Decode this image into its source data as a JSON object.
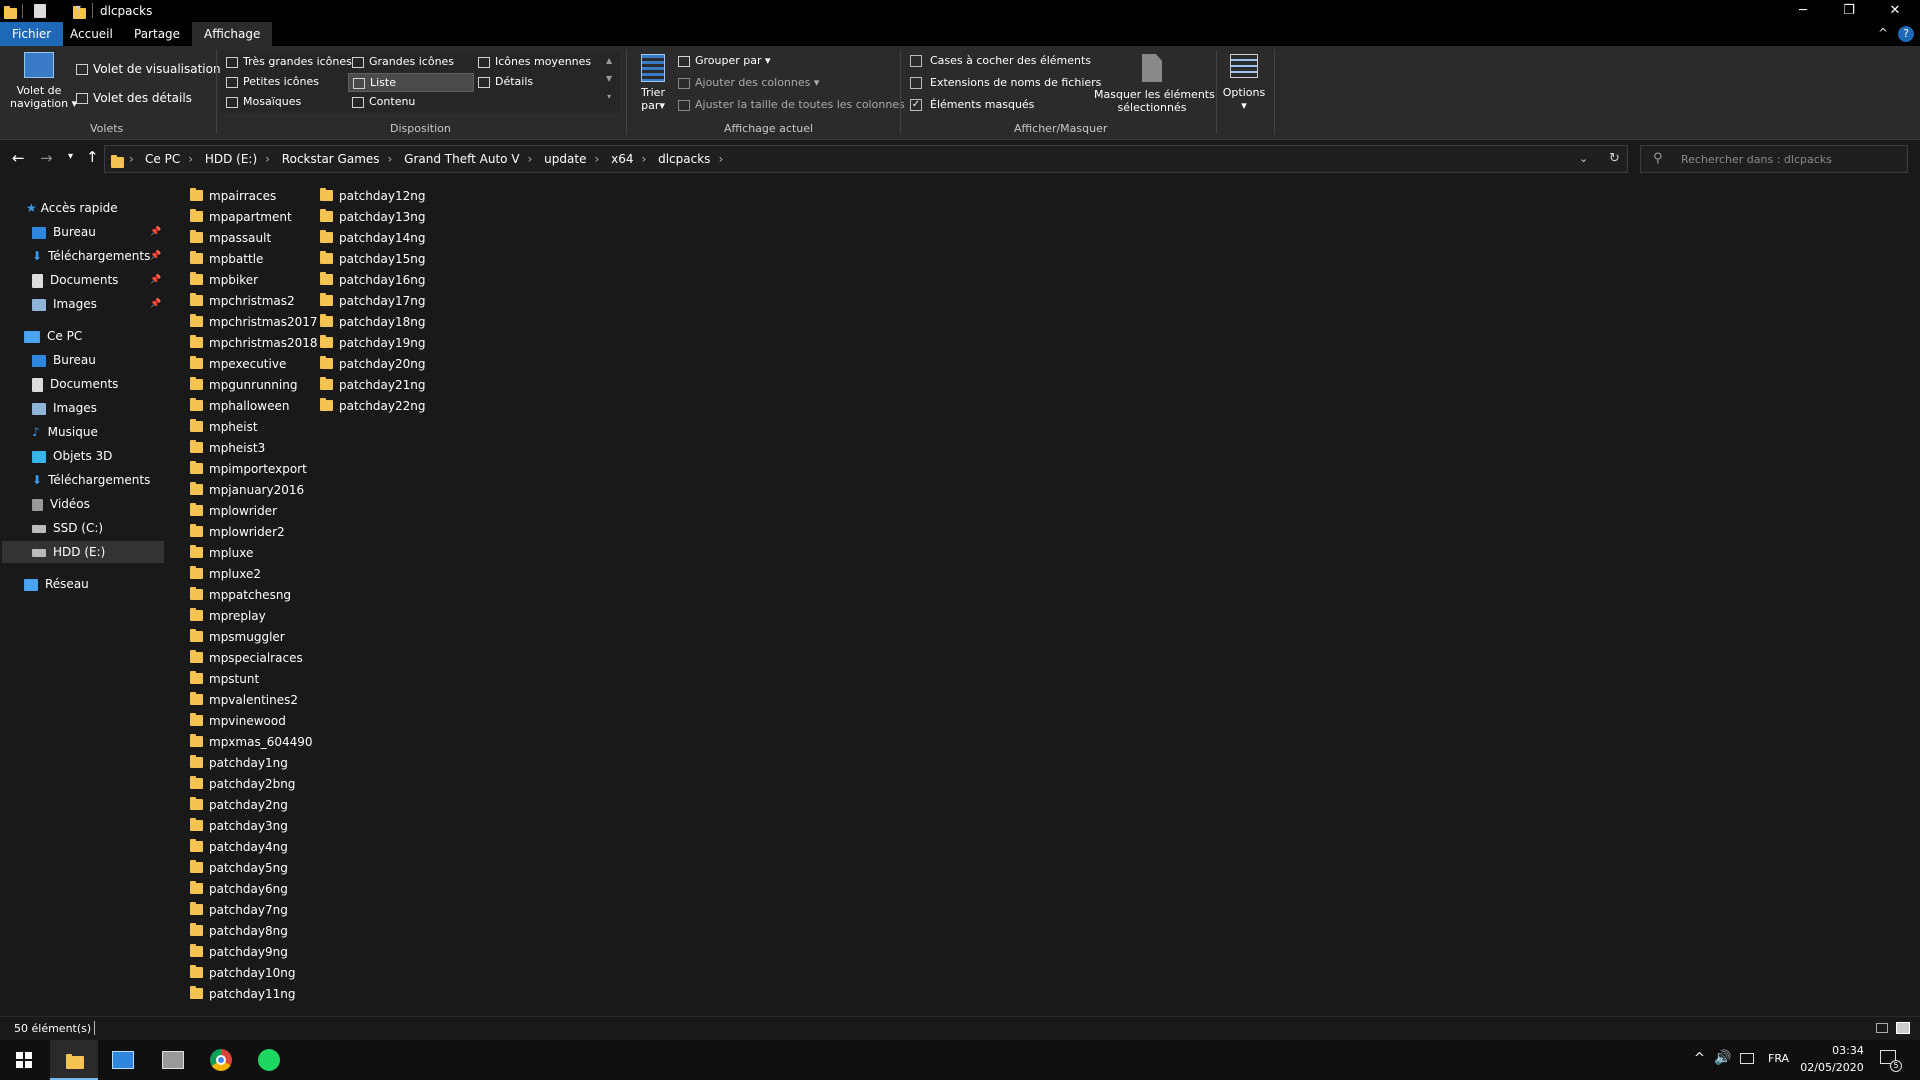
{
  "window": {
    "title": "dlcpacks"
  },
  "tabs": [
    "Fichier",
    "Accueil",
    "Partage",
    "Affichage"
  ],
  "ribbon": {
    "volets": {
      "nav_pane_line1": "Volet de",
      "nav_pane_line2": "navigation",
      "preview": "Volet de visualisation",
      "details": "Volet des détails",
      "group": "Volets"
    },
    "disposition": {
      "items": [
        "Très grandes icônes",
        "Grandes icônes",
        "Icônes moyennes",
        "Petites icônes",
        "Liste",
        "Détails",
        "Mosaïques",
        "Contenu"
      ],
      "group": "Disposition"
    },
    "affichage": {
      "sort_line1": "Trier",
      "sort_line2": "par",
      "group_by": "Grouper par",
      "add_columns": "Ajouter des colonnes",
      "fit_columns": "Ajuster la taille de toutes les colonnes",
      "group": "Affichage actuel"
    },
    "afficher": {
      "checkboxes": "Cases à cocher des éléments",
      "extensions": "Extensions de noms de fichiers",
      "hidden": "Éléments masqués",
      "hide_selected_line1": "Masquer les éléments",
      "hide_selected_line2": "sélectionnés",
      "group": "Afficher/Masquer"
    },
    "options": "Options"
  },
  "address": {
    "crumbs": [
      "Ce PC",
      "HDD (E:)",
      "Rockstar Games",
      "Grand Theft Auto V",
      "update",
      "x64",
      "dlcpacks"
    ],
    "search_placeholder": "Rechercher dans : dlcpacks"
  },
  "nav": {
    "quick_access": "Accès rapide",
    "quick_items": [
      "Bureau",
      "Téléchargements",
      "Documents",
      "Images"
    ],
    "this_pc": "Ce PC",
    "pc_items": [
      "Bureau",
      "Documents",
      "Images",
      "Musique",
      "Objets 3D",
      "Téléchargements",
      "Vidéos",
      "SSD (C:)",
      "HDD (E:)"
    ],
    "network": "Réseau"
  },
  "files": {
    "col1": [
      "mpairraces",
      "mpapartment",
      "mpassault",
      "mpbattle",
      "mpbiker",
      "mpchristmas2",
      "mpchristmas2017",
      "mpchristmas2018",
      "mpexecutive",
      "mpgunrunning",
      "mphalloween",
      "mpheist",
      "mpheist3",
      "mpimportexport",
      "mpjanuary2016",
      "mplowrider",
      "mplowrider2",
      "mpluxe",
      "mpluxe2",
      "mppatchesng",
      "mpreplay",
      "mpsmuggler",
      "mpspecialraces",
      "mpstunt",
      "mpvalentines2",
      "mpvinewood",
      "mpxmas_604490",
      "patchday1ng",
      "patchday2bng",
      "patchday2ng",
      "patchday3ng",
      "patchday4ng",
      "patchday5ng",
      "patchday6ng",
      "patchday7ng",
      "patchday8ng",
      "patchday9ng",
      "patchday10ng",
      "patchday11ng"
    ],
    "col2": [
      "patchday12ng",
      "patchday13ng",
      "patchday14ng",
      "patchday15ng",
      "patchday16ng",
      "patchday17ng",
      "patchday18ng",
      "patchday19ng",
      "patchday20ng",
      "patchday21ng",
      "patchday22ng"
    ]
  },
  "status": {
    "count": "50 élément(s)"
  },
  "taskbar": {
    "lang": "FRA",
    "time": "03:34",
    "date": "02/05/2020",
    "notif": "5"
  },
  "colors": {
    "accent": "#1e68b8",
    "folder": "#f4c351",
    "bg": "#191919",
    "ribbon": "#2b2b2b"
  }
}
